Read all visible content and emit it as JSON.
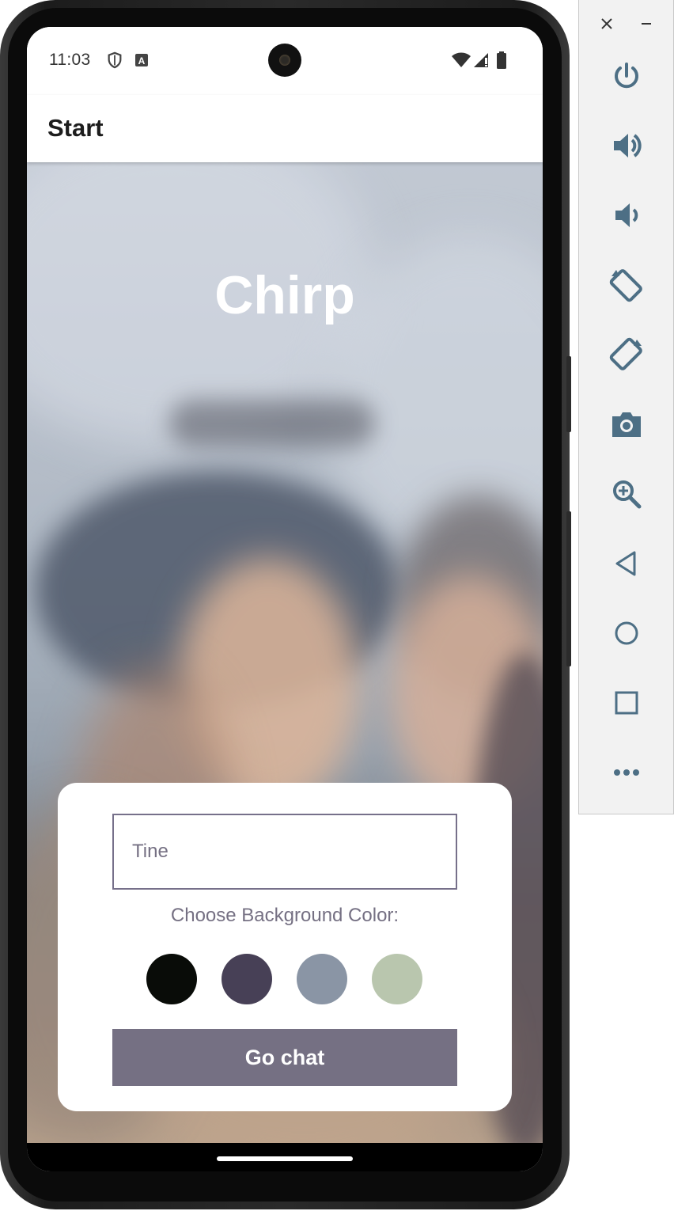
{
  "status_bar": {
    "time": "11:03",
    "left_icons": [
      "shield-icon",
      "font-a-icon"
    ],
    "right_icons": [
      "wifi-icon",
      "signal-icon",
      "battery-icon"
    ]
  },
  "app_bar": {
    "title": "Start"
  },
  "hero": {
    "title": "Chirp"
  },
  "form": {
    "name_input_value": "Tine",
    "color_label": "Choose Background Color:",
    "colors": [
      "#090C08",
      "#474056",
      "#8A95A5",
      "#B9C6AE"
    ],
    "button_label": "Go chat"
  },
  "emulator_toolbar": {
    "window_controls": [
      "close-icon",
      "minimize-icon"
    ],
    "buttons": [
      "power-icon",
      "volume-up-icon",
      "volume-down-icon",
      "rotate-left-icon",
      "rotate-right-icon",
      "camera-icon",
      "zoom-icon",
      "back-icon",
      "home-icon",
      "overview-icon",
      "more-icon"
    ]
  }
}
